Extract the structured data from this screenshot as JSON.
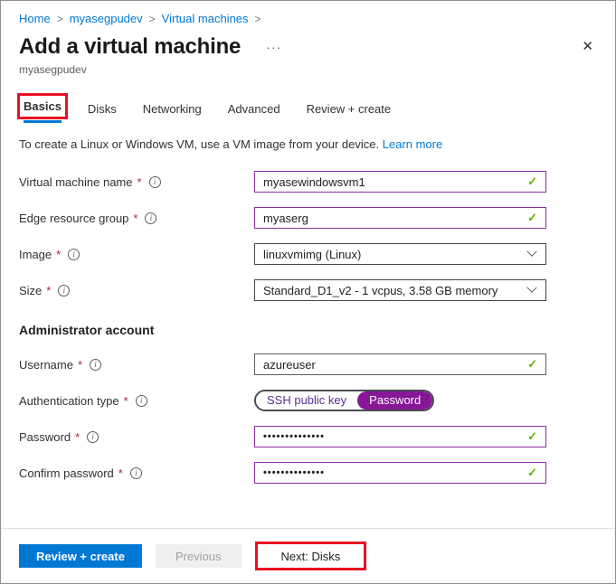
{
  "breadcrumb": {
    "separator": ">",
    "items": [
      {
        "label": "Home"
      },
      {
        "label": "myasegpudev"
      },
      {
        "label": "Virtual machines"
      }
    ]
  },
  "header": {
    "title": "Add a virtual machine",
    "ellipsis": "···",
    "close_glyph": "✕",
    "subtitle": "myasegpudev"
  },
  "tabs": [
    {
      "label": "Basics"
    },
    {
      "label": "Disks"
    },
    {
      "label": "Networking"
    },
    {
      "label": "Advanced"
    },
    {
      "label": "Review + create"
    }
  ],
  "active_tab": "Basics",
  "intro": {
    "text": "To create a Linux or Windows VM, use a VM image from your device.",
    "link": "Learn more"
  },
  "form": {
    "required_marker": "*",
    "info_glyph": "i",
    "check_glyph": "✓",
    "section_heading": "Administrator account",
    "fields": [
      {
        "label": "Virtual machine name",
        "value": "myasewindowsvm1",
        "control": "text",
        "state": "valid"
      },
      {
        "label": "Edge resource group",
        "value": "myaserg",
        "control": "text",
        "state": "valid"
      },
      {
        "label": "Image",
        "value": "linuxvmimg (Linux)",
        "control": "dropdown"
      },
      {
        "label": "Size",
        "value": "Standard_D1_v2 - 1 vcpus, 3.58 GB memory",
        "control": "dropdown"
      },
      {
        "label": "Username",
        "value": "azureuser",
        "control": "text",
        "state": "valid"
      },
      {
        "label": "Authentication type",
        "control": "toggle"
      },
      {
        "label": "Password",
        "value": "••••••••••••••",
        "control": "password",
        "state": "valid"
      },
      {
        "label": "Confirm password",
        "value": "••••••••••••••",
        "control": "password",
        "state": "valid"
      }
    ],
    "auth": {
      "options": [
        "SSH public key",
        "Password"
      ],
      "selected": "Password"
    }
  },
  "footer": {
    "buttons": [
      {
        "label": "Review + create",
        "style": "primary"
      },
      {
        "label": "Previous",
        "style": "disabled"
      },
      {
        "label": "Next: Disks",
        "style": "annotated"
      }
    ]
  },
  "colors": {
    "accent": "#0078d4",
    "edited_field_border": "#8a2da5",
    "valid_check": "#5db300",
    "toggle_selected_fill": "#881798",
    "annotation_red": "#e81123",
    "required_red": "#a4262c"
  }
}
